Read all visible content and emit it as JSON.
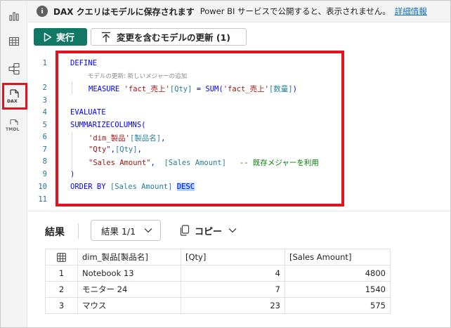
{
  "info_bar": {
    "bold_text": "DAX クエリはモデルに保存されます",
    "text": "Power BI サービスで公開すると、表示されません。",
    "link": "詳細情報"
  },
  "toolbar": {
    "run_label": "実行",
    "update_label": "変更を含むモデルの更新 (1)"
  },
  "rail": {
    "dax_label": "DAX",
    "tmdl_label": "TMDL"
  },
  "editor": {
    "line_numbers": [
      "1",
      "2",
      "3",
      "4",
      "5",
      "6",
      "7",
      "8",
      "9",
      "10",
      "11"
    ],
    "codelens": "モデルの更新: 新しいメジャーの追加",
    "lines": {
      "l1": "DEFINE",
      "l2_kw": "MEASURE ",
      "l2_a": "'fact_売上'",
      "l2_b": "[Qty]",
      "l2_c": " = SUM(",
      "l2_d": "'fact_売上'",
      "l2_e": "[数量]",
      "l2_f": ")",
      "l5": "EVALUATE",
      "l6": "SUMMARIZECOLUMNS(",
      "l7_a": "'dim_製品'",
      "l7_b": "[製品名]",
      "l7_c": ",",
      "l8_a": "\"Qty\"",
      "l8_b": ",",
      "l8_c": "[Qty]",
      "l8_d": ",",
      "l9_a": "\"Sales Amount\"",
      "l9_b": ",  ",
      "l9_c": "[Sales Amount]",
      "l9_d": "   -- 既存メジャーを利用",
      "l10": ")",
      "l11_a": "ORDER BY ",
      "l11_b": "[Sales Amount]",
      "l11_c": " ",
      "l11_d": "DESC"
    }
  },
  "results": {
    "title": "結果",
    "selector_label": "結果 1/1",
    "copy_label": "コピー",
    "columns": [
      "dim_製品[製品名]",
      "[Qty]",
      "[Sales Amount]"
    ],
    "rows": [
      {
        "idx": "1",
        "name": "Notebook 13",
        "qty": "4",
        "sales": "4800"
      },
      {
        "idx": "2",
        "name": "モニター 24",
        "qty": "7",
        "sales": "1540"
      },
      {
        "idx": "3",
        "name": "マウス",
        "qty": "23",
        "sales": "575"
      }
    ]
  },
  "colors": {
    "run_button": "#117865",
    "highlight_box": "#e0141e",
    "link": "#0f6cbd"
  },
  "icons": [
    "report-view-icon",
    "table-view-icon",
    "model-view-icon",
    "dax-query-view-icon",
    "tmdl-view-icon",
    "info-icon",
    "play-icon",
    "upload-icon",
    "chevron-down-icon",
    "copy-icon",
    "table-grid-icon"
  ]
}
